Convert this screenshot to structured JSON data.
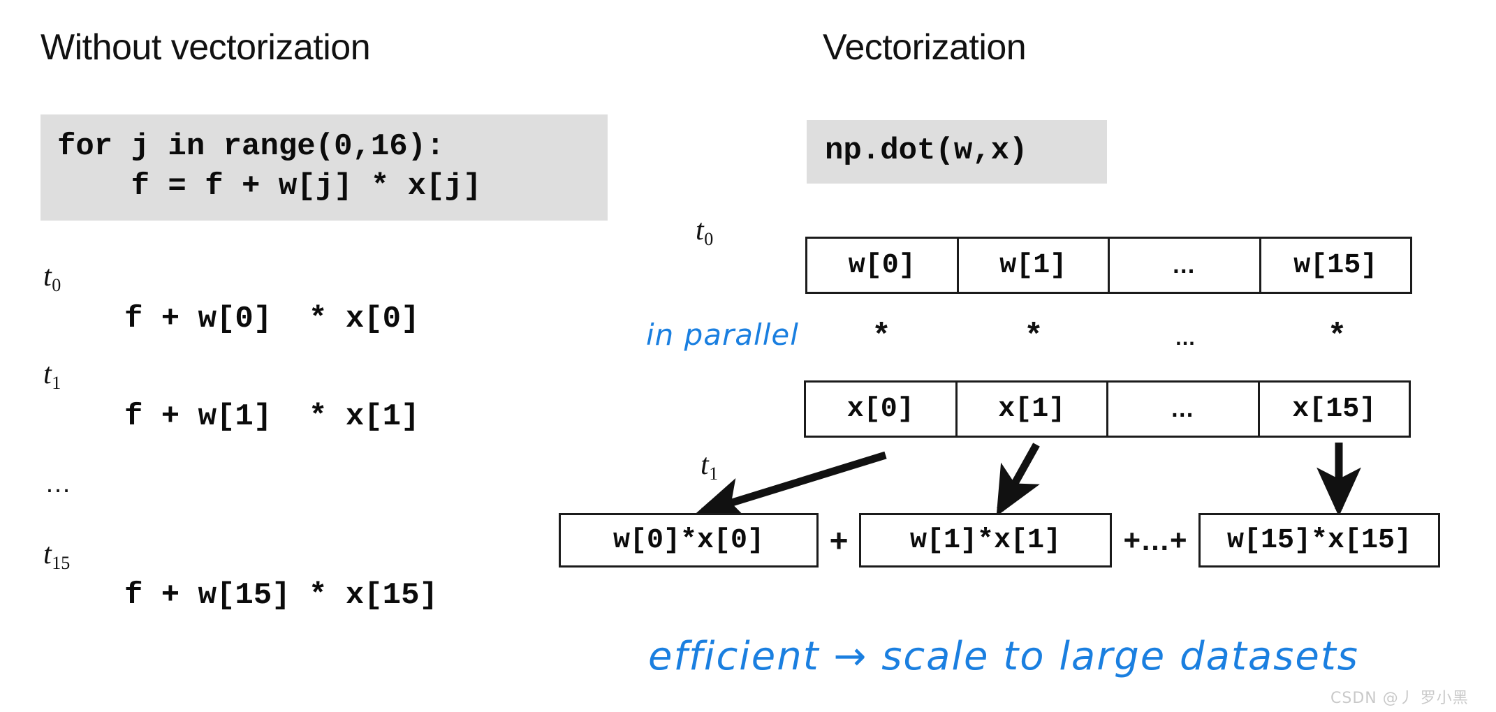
{
  "left_panel": {
    "heading": "Without vectorization",
    "code": "for j in range(0,16):\n    f = f + w[j] * x[j]",
    "steps": [
      {
        "time": "t",
        "sub": "0",
        "expr": "f + w[0]  * x[0]"
      },
      {
        "time": "t",
        "sub": "1",
        "expr": "f + w[1]  * x[1]"
      },
      {
        "ellipsis": "…"
      },
      {
        "time": "t",
        "sub": "15",
        "expr": "f + w[15] * x[15]"
      }
    ]
  },
  "right_panel": {
    "heading": "Vectorization",
    "code": "np.dot(w,x)",
    "t0_label": {
      "time": "t",
      "sub": "0"
    },
    "t1_label": {
      "time": "t",
      "sub": "1"
    },
    "w_array": {
      "name": "w",
      "cells": [
        "w[0]",
        "w[1]",
        "…",
        "w[15]"
      ]
    },
    "x_array": {
      "name": "x",
      "cells": [
        "x[0]",
        "x[1]",
        "…",
        "x[15]"
      ]
    },
    "operator_row": {
      "note": "in parallel",
      "ops": [
        "*",
        "*",
        "…",
        "*"
      ]
    },
    "result_row": {
      "boxes": [
        "w[0]*x[0]",
        "w[1]*x[1]",
        "w[15]*x[15]"
      ],
      "separators": [
        "+",
        "+…+"
      ]
    },
    "conclusion": "efficient → scale to large datasets"
  },
  "watermark": "CSDN @丿 罗小黑",
  "colors": {
    "handwriting_blue": "#1a7fe0",
    "code_background": "#dedede",
    "ink_black": "#111111",
    "box_border": "#1b1b1b",
    "watermark_gray": "#c9c9c9"
  }
}
